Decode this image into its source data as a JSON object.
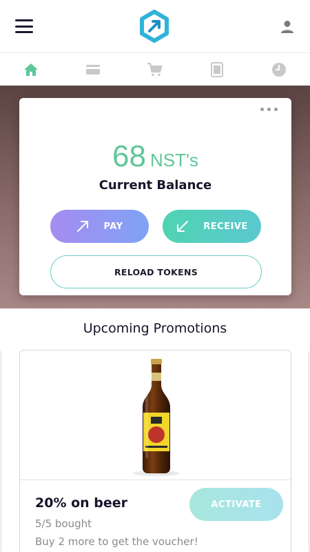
{
  "header": {
    "menu_icon": "hamburger-menu-icon",
    "logo_icon": "hexagon-arrow-logo",
    "user_icon": "user-icon"
  },
  "tabs": [
    {
      "name": "home",
      "icon": "home-icon",
      "active": true
    },
    {
      "name": "cards",
      "icon": "credit-card-icon",
      "active": false
    },
    {
      "name": "shop",
      "icon": "cart-icon",
      "active": false
    },
    {
      "name": "calculator",
      "icon": "calculator-icon",
      "active": false
    },
    {
      "name": "history",
      "icon": "clock-icon",
      "active": false
    }
  ],
  "balance": {
    "amount": "68",
    "unit": "NST's",
    "label": "Current Balance",
    "more_icon": "more-dots-icon"
  },
  "actions": {
    "pay_label": "PAY",
    "receive_label": "RECEIVE",
    "reload_label": "RELOAD TOKENS"
  },
  "promotions": {
    "title": "Upcoming Promotions",
    "items": [
      {
        "name": "20% on beer",
        "progress": "5/5 bought",
        "hint": "Buy 2 more to get the voucher!",
        "activate_label": "ACTIVATE",
        "image": "beer-bottle"
      }
    ]
  },
  "colors": {
    "accent_green": "#5fc79a",
    "pay_gradient": [
      "#a58cf0",
      "#7fa3f5"
    ],
    "receive_gradient": [
      "#4fd3b1",
      "#5bc8cf"
    ],
    "hero_gradient": [
      "#5a4341",
      "#a88886"
    ]
  }
}
